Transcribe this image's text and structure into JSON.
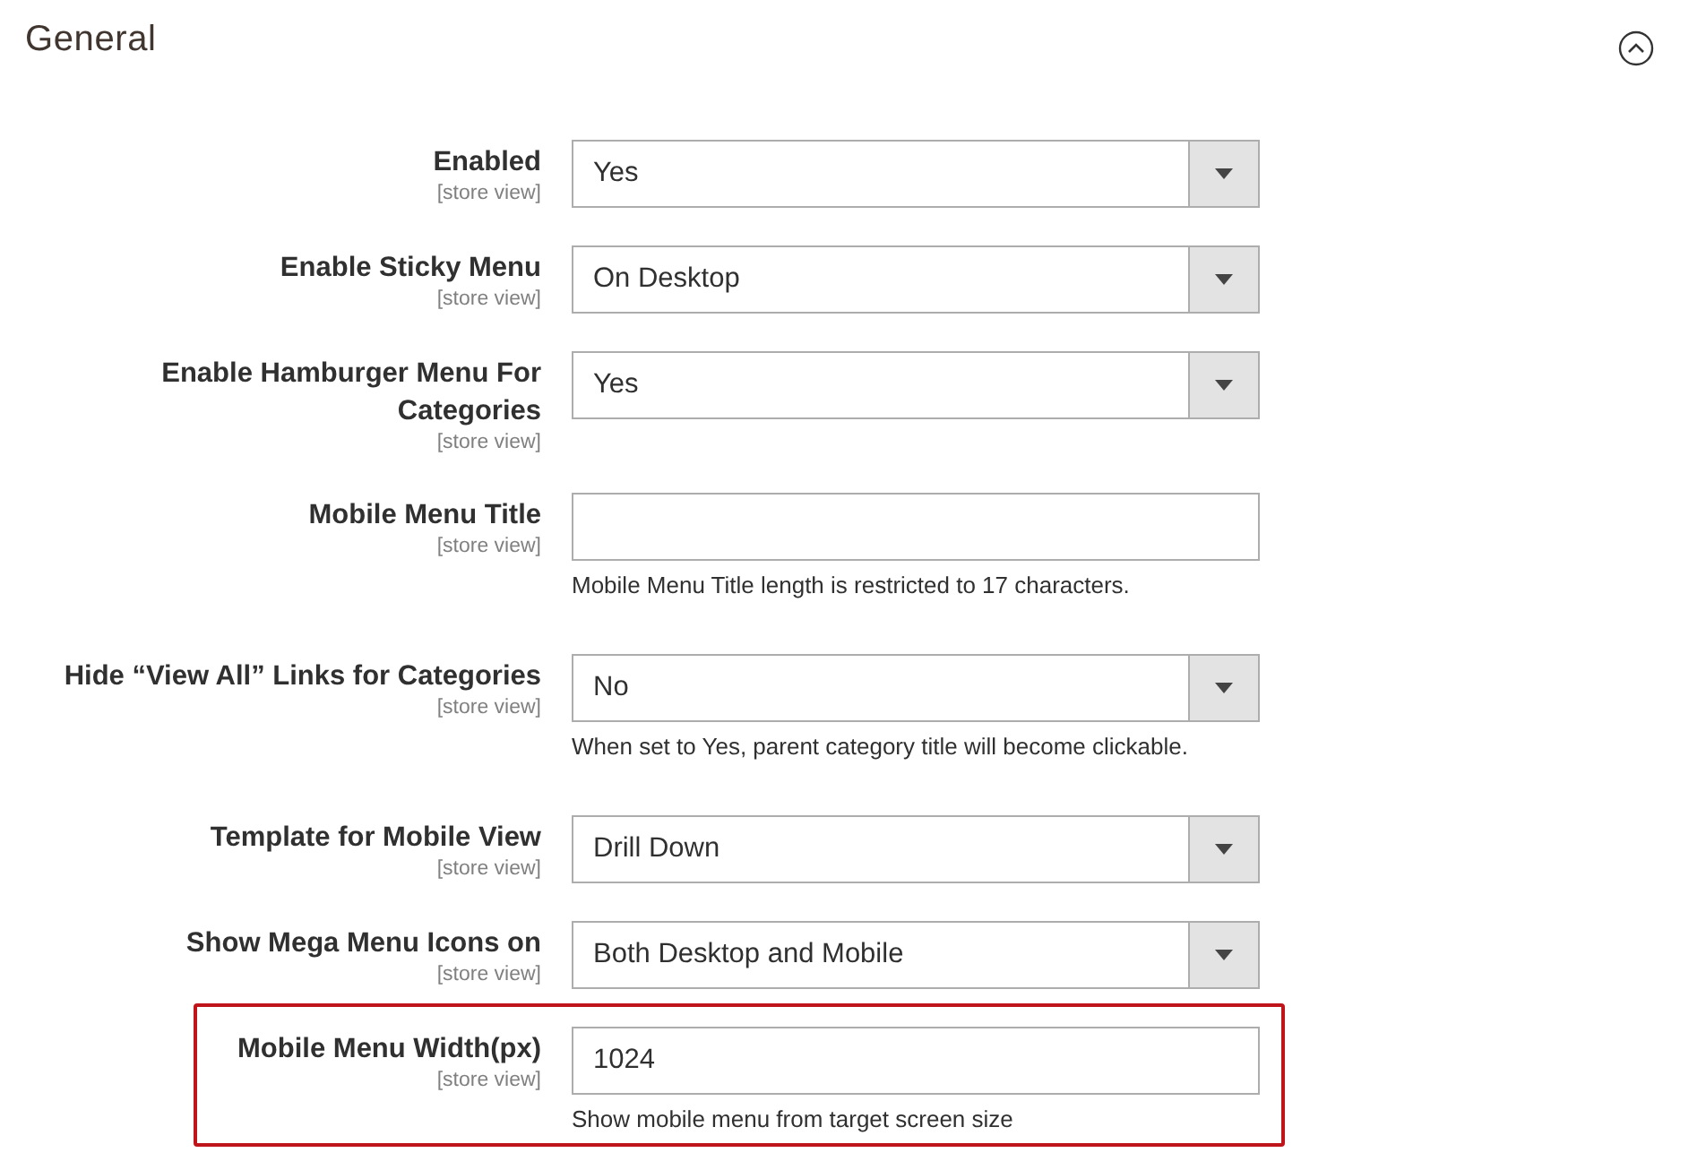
{
  "section": {
    "title": "General",
    "expanded": true
  },
  "fields": [
    {
      "kind": "select",
      "label": "Enabled",
      "scope": "[store view]",
      "value": "Yes",
      "highlighted": false
    },
    {
      "kind": "select",
      "label": "Enable Sticky Menu",
      "scope": "[store view]",
      "value": "On Desktop",
      "highlighted": false
    },
    {
      "kind": "select",
      "label": "Enable Hamburger Menu For Categories",
      "scope": "[store view]",
      "value": "Yes",
      "highlighted": false
    },
    {
      "kind": "text",
      "label": "Mobile Menu Title",
      "scope": "[store view]",
      "note": "Mobile Menu Title length is restricted to 17 characters.",
      "highlighted": false
    },
    {
      "kind": "select",
      "label": "Hide “View All” Links for Categories",
      "scope": "[store view]",
      "value": "No",
      "note": "When set to Yes, parent category title will become clickable.",
      "highlighted": false
    },
    {
      "kind": "select",
      "label": "Template for Mobile View",
      "scope": "[store view]",
      "value": "Drill Down",
      "highlighted": false
    },
    {
      "kind": "select",
      "label": "Show Mega Menu Icons on",
      "scope": "[store view]",
      "value": "Both Desktop and Mobile",
      "highlighted": false
    },
    {
      "kind": "text",
      "label": "Mobile Menu Width(px)",
      "scope": "[store view]",
      "value": "1024",
      "note": "Show mobile menu from target screen size",
      "highlighted": true
    }
  ]
}
